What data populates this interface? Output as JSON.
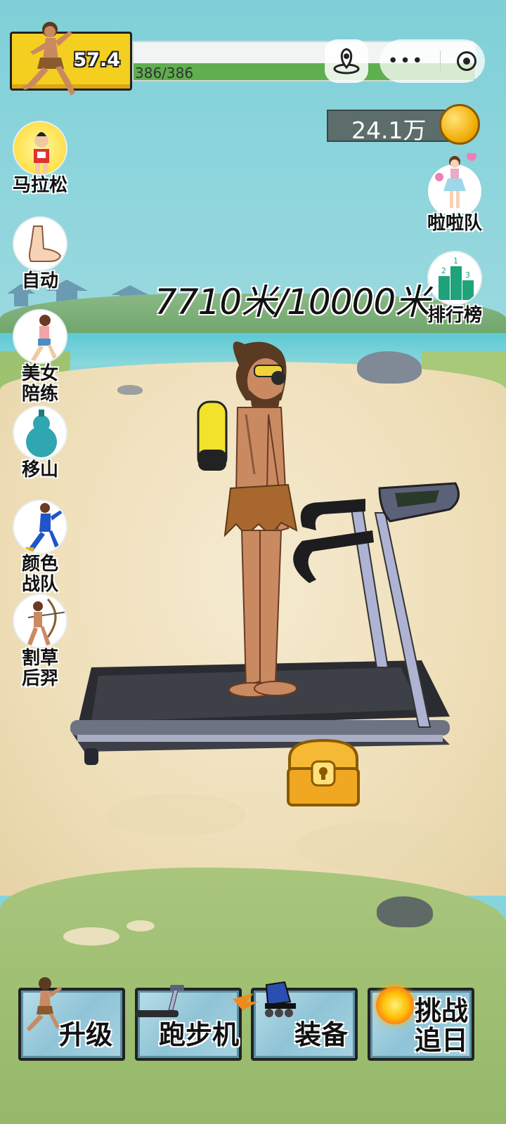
{
  "hud": {
    "speed": "57.4",
    "stamina_text": "386/386",
    "stamina_level": 1.0,
    "coins": "24.1万"
  },
  "side_left": [
    {
      "label": "马拉松",
      "icon": "marathon-runner-icon"
    },
    {
      "label": "自动",
      "icon": "foot-icon"
    },
    {
      "label": "美女陪练",
      "icon": "girl-runner-icon"
    },
    {
      "label": "移山",
      "icon": "gourd-icon"
    },
    {
      "label": "颜色战队",
      "icon": "blue-runner-icon"
    },
    {
      "label": "割草后羿",
      "icon": "archer-icon"
    }
  ],
  "side_right": [
    {
      "label": "啦啦队",
      "icon": "cheerleader-icon"
    },
    {
      "label": "排行榜",
      "icon": "podium-icon"
    }
  ],
  "distance": "7710米/10000米",
  "bottom_buttons": [
    {
      "label": "升级",
      "icon": "caveman-runner-icon"
    },
    {
      "label": "跑步机",
      "icon": "treadmill-icon"
    },
    {
      "label": "装备",
      "icon": "roller-skate-icon"
    },
    {
      "label_line1": "挑战",
      "label_line2": "追日",
      "icon": "sun-icon"
    }
  ],
  "colors": {
    "hud_yellow": "#f5cf1f",
    "stamina_green": "#5fae4f",
    "button_blue": "#a8d3e2"
  }
}
